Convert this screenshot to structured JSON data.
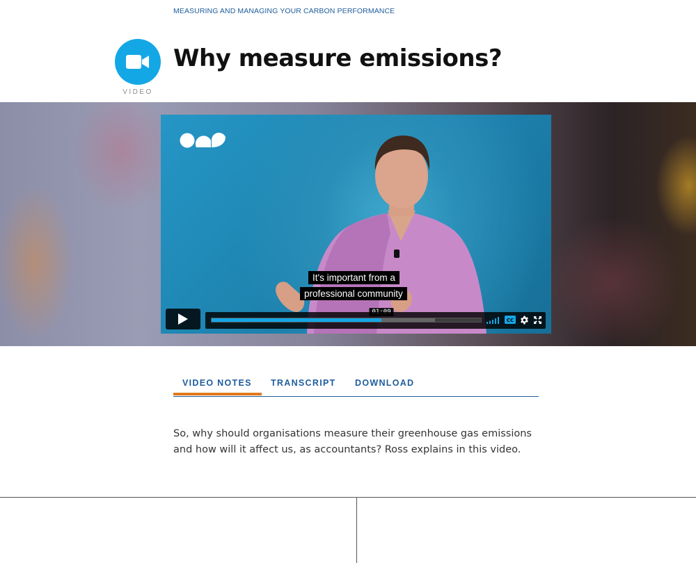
{
  "breadcrumb": "MEASURING AND MANAGING YOUR CARBON PERFORMANCE",
  "badge": {
    "label": "VIDEO",
    "icon": "video-camera-icon",
    "color": "#13a7e6"
  },
  "title": "Why measure emissions?",
  "player": {
    "captions": [
      "It's important from a",
      "professional community"
    ],
    "current_time": "01:09",
    "progress_fraction": 0.63,
    "buffered_fraction": 0.83,
    "controls": [
      "play-icon",
      "volume-icon",
      "cc-icon",
      "settings-icon",
      "fullscreen-icon"
    ]
  },
  "tabs": [
    {
      "label": "VIDEO NOTES",
      "active": true
    },
    {
      "label": "TRANSCRIPT",
      "active": false
    },
    {
      "label": "DOWNLOAD",
      "active": false
    }
  ],
  "notes": "So, why should organisations measure their greenhouse gas emissions and how will it affect us, as accountants? Ross explains in this video.",
  "colors": {
    "accent": "#13a7e6",
    "link": "#1f5d9c",
    "active_tab": "#e07a1f"
  }
}
